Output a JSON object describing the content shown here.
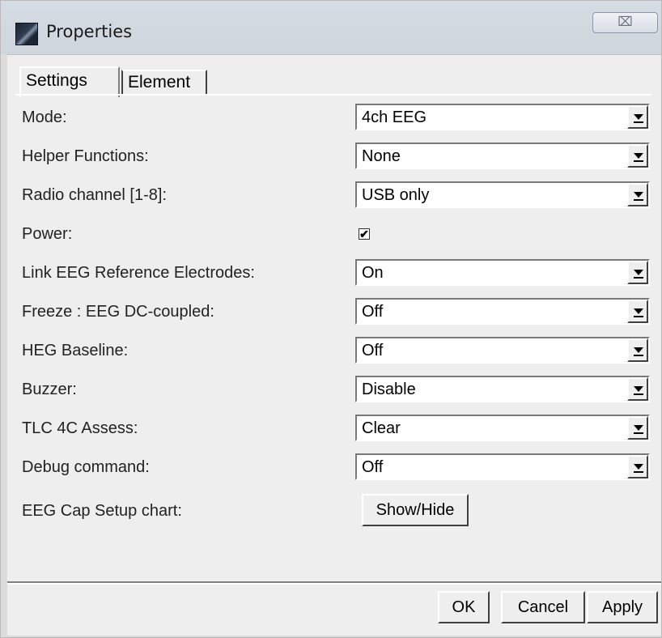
{
  "window": {
    "title": "Properties",
    "close_label": "⌧"
  },
  "tabs": [
    {
      "label": "Settings"
    },
    {
      "label": "Element"
    }
  ],
  "rows": [
    {
      "label": "Mode:",
      "value": "4ch EEG"
    },
    {
      "label": "Helper Functions:",
      "value": "None"
    },
    {
      "label": "Radio channel [1-8]:",
      "value": "USB only"
    },
    {
      "label": "Power:",
      "checked": true,
      "check_glyph": "✔"
    },
    {
      "label": "Link EEG Reference Electrodes:",
      "value": "On"
    },
    {
      "label": "Freeze : EEG DC-coupled:",
      "value": "Off"
    },
    {
      "label": "HEG Baseline:",
      "value": "Off"
    },
    {
      "label": "Buzzer:",
      "value": "Disable"
    },
    {
      "label": "TLC 4C Assess:",
      "value": "Clear"
    },
    {
      "label": "Debug command:",
      "value": "Off"
    },
    {
      "label": "EEG Cap Setup chart:",
      "button": "Show/Hide"
    }
  ],
  "footer": {
    "ok": "OK",
    "cancel": "Cancel",
    "apply": "Apply"
  }
}
